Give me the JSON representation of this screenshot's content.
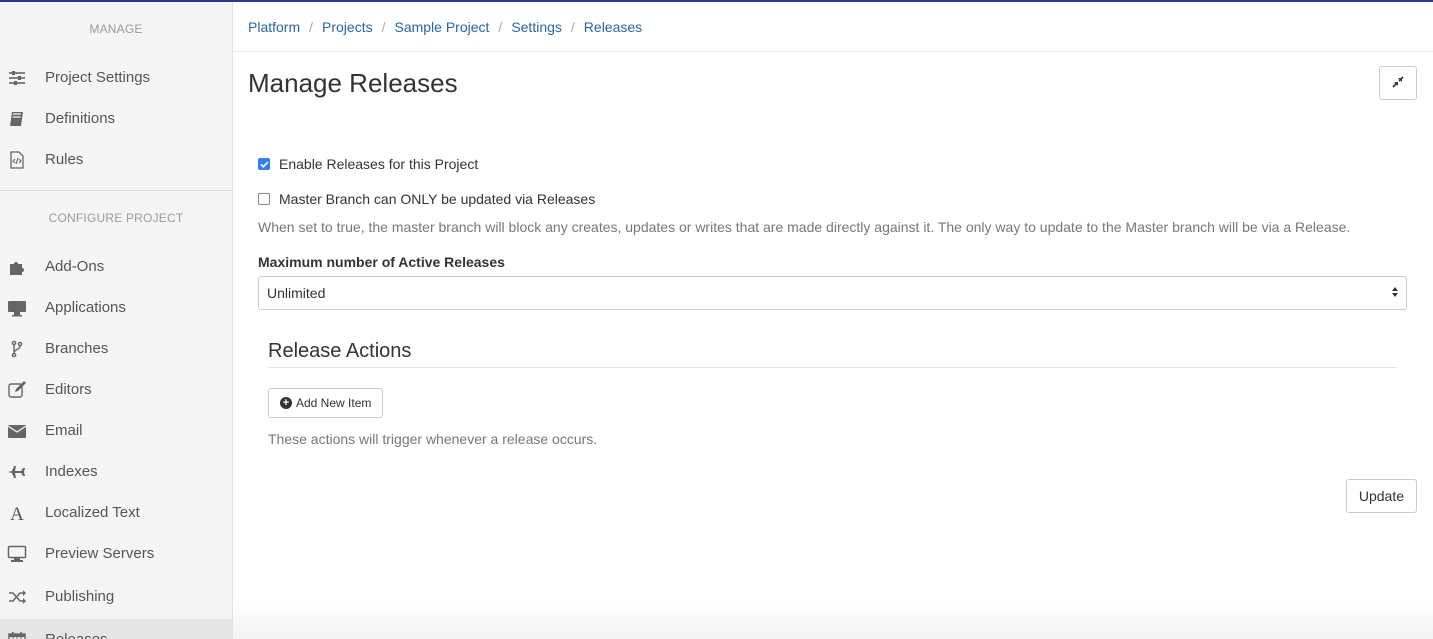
{
  "sidebar": {
    "manage_heading": "MANAGE",
    "manage_items": [
      {
        "label": "Project Settings",
        "icon": "sliders-icon"
      },
      {
        "label": "Definitions",
        "icon": "book-icon"
      },
      {
        "label": "Rules",
        "icon": "code-file-icon"
      }
    ],
    "configure_heading": "CONFIGURE PROJECT",
    "configure_items": [
      {
        "label": "Add-Ons",
        "icon": "puzzle-icon"
      },
      {
        "label": "Applications",
        "icon": "desktop-icon"
      },
      {
        "label": "Branches",
        "icon": "branch-icon"
      },
      {
        "label": "Editors",
        "icon": "edit-icon"
      },
      {
        "label": "Email",
        "icon": "envelope-icon"
      },
      {
        "label": "Indexes",
        "icon": "plane-icon"
      },
      {
        "label": "Localized Text",
        "icon": "font-icon"
      },
      {
        "label": "Preview Servers",
        "icon": "monitor-icon"
      },
      {
        "label": "Publishing",
        "icon": "shuffle-icon"
      },
      {
        "label": "Releases",
        "icon": "calendar-icon"
      }
    ],
    "active_item": "Releases"
  },
  "breadcrumb": [
    "Platform",
    "Projects",
    "Sample Project",
    "Settings",
    "Releases"
  ],
  "page": {
    "title": "Manage Releases"
  },
  "form": {
    "enable_releases_label": "Enable Releases for this Project",
    "enable_releases_checked": true,
    "master_branch_label": "Master Branch can ONLY be updated via Releases",
    "master_branch_checked": false,
    "master_branch_help": "When set to true, the master branch will block any creates, updates or writes that are made directly against it. The only way to update to the Master branch will be via a Release.",
    "max_releases_label": "Maximum number of Active Releases",
    "max_releases_value": "Unlimited"
  },
  "release_actions": {
    "title": "Release Actions",
    "add_button": "Add New Item",
    "help": "These actions will trigger whenever a release occurs."
  },
  "update_button": "Update",
  "colors": {
    "link": "#2a64a8",
    "checkbox_checked": "#2f7ff0",
    "top_border": "#2b3a8c"
  }
}
